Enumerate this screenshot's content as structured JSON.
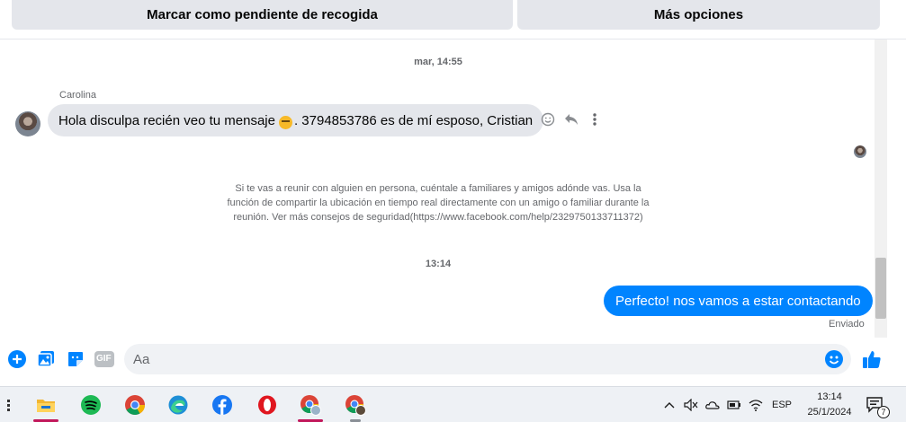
{
  "top_actions": {
    "mark_pending": "Marcar como pendiente de recogida",
    "more_options": "Más opciones"
  },
  "chat": {
    "timestamp_1": "mar, 14:55",
    "sender_name": "Carolina",
    "incoming_message_part1": "Hola disculpa recién veo tu mensaje",
    "incoming_message_part2": ". 3794853786 es de mí esposo, Cristian",
    "incoming_emoji": "tired-face-emoji",
    "safety_notice": "Si te vas a reunir con alguien en persona, cuéntale a familiares y amigos adónde vas. Usa la función de compartir la ubicación en tiempo real directamente con un amigo o familiar durante la reunión. Ver más consejos de seguridad(https://www.facebook.com/help/2329750133711372)",
    "timestamp_2": "13:14",
    "outgoing_message": "Perfecto! nos vamos a estar contactando",
    "sent_status": "Enviado"
  },
  "composer": {
    "placeholder": "Aa",
    "gif_label": "GIF"
  },
  "taskbar": {
    "apps": [
      "file-explorer",
      "spotify",
      "chrome",
      "edge",
      "facebook",
      "opera",
      "chrome-profile",
      "chrome-profile-2"
    ],
    "language": "ESP",
    "time": "13:14",
    "date": "25/1/2024",
    "notification_count": "7"
  },
  "colors": {
    "messenger_blue": "#0084ff",
    "bubble_grey": "#e4e6eb",
    "secondary_text": "#65676b"
  }
}
